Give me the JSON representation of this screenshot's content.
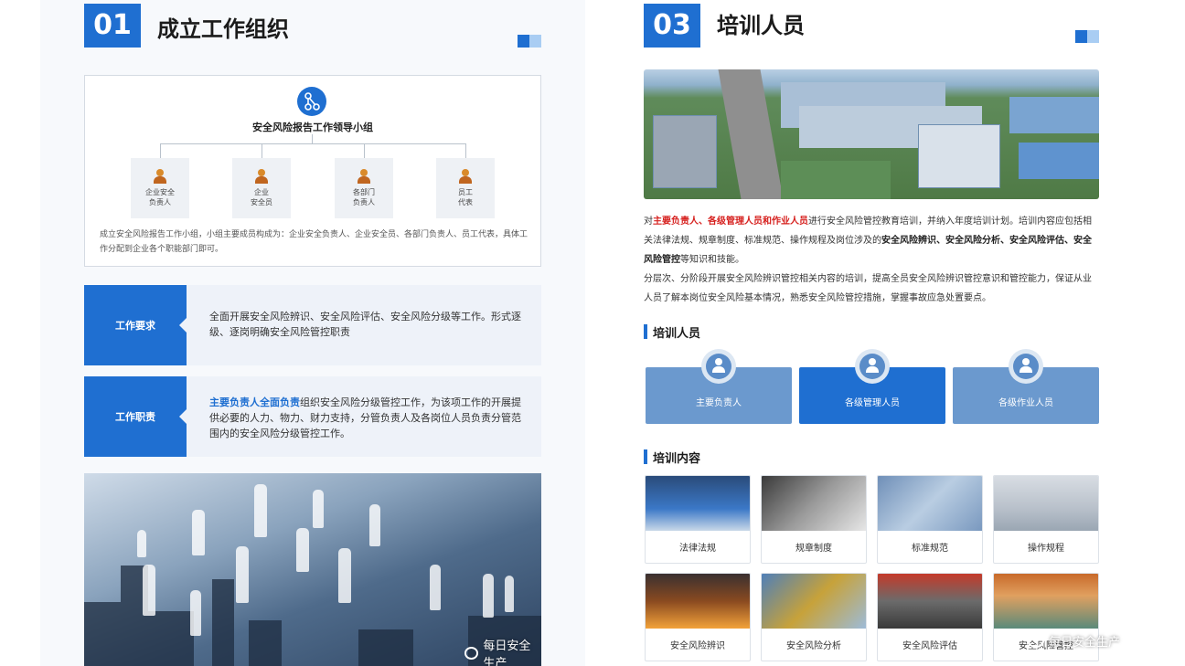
{
  "left": {
    "section_number": "01",
    "section_title": "成立工作组织",
    "org": {
      "head_label": "安全风险报告工作领导小组",
      "members": [
        {
          "label": "企业安全\n负责人"
        },
        {
          "label": "企业\n安全员"
        },
        {
          "label": "各部门\n负责人"
        },
        {
          "label": "员工\n代表"
        }
      ],
      "description": "成立安全风险报告工作小组，小组主要成员构成为：企业安全负责人、企业安全员、各部门负责人、员工代表，具体工作分配到企业各个职能部门即可。"
    },
    "requirement": {
      "tag": "工作要求",
      "text": "全面开展安全风险辨识、安全风险评估、安全风险分级等工作。形式逐级、逐岗明确安全风险管控职责"
    },
    "duty": {
      "tag": "工作职责",
      "highlight": "主要负责人全面负责",
      "text": "组织安全风险分级管控工作，为该项工作的开展提供必要的人力、物力、财力支持，分管负责人及各岗位人员负责分管范围内的安全风险分级管控工作。"
    },
    "watermark": "每日安全生产"
  },
  "right": {
    "section_number": "03",
    "section_title": "培训人员",
    "intro": {
      "p1_prefix": "对",
      "p1_highlight": "主要负责人、各级管理人员和作业人员",
      "p1_mid": "进行安全风险管控教育培训，并纳入年度培训计划。培训内容应包括相关法律法规、规章制度、标准规范、操作规程及岗位涉及的",
      "p1_bold": "安全风险辨识、安全风险分析、安全风险评估、安全风险管控",
      "p1_suffix": "等知识和技能。",
      "p2": "分层次、分阶段开展安全风险辨识管控相关内容的培训，提高全员安全风险辨识管控意识和管控能力，保证从业人员了解本岗位安全风险基本情况，熟悉安全风险管控措施，掌握事故应急处置要点。"
    },
    "trainees_heading": "培训人员",
    "trainees": [
      {
        "label": "主要负责人"
      },
      {
        "label": "各级管理人员"
      },
      {
        "label": "各级作业人员"
      }
    ],
    "contents_heading": "培训内容",
    "contents": [
      {
        "label": "法律法规"
      },
      {
        "label": "规章制度"
      },
      {
        "label": "标准规范"
      },
      {
        "label": "操作规程"
      },
      {
        "label": "安全风险辨识"
      },
      {
        "label": "安全风险分析"
      },
      {
        "label": "安全风险评估"
      },
      {
        "label": "安全风险管控"
      }
    ],
    "watermark": "每日安全生产"
  },
  "colors": {
    "primary": "#1f6fd1",
    "light_blue": "#6b99ce",
    "highlight_red": "#d6201e"
  }
}
